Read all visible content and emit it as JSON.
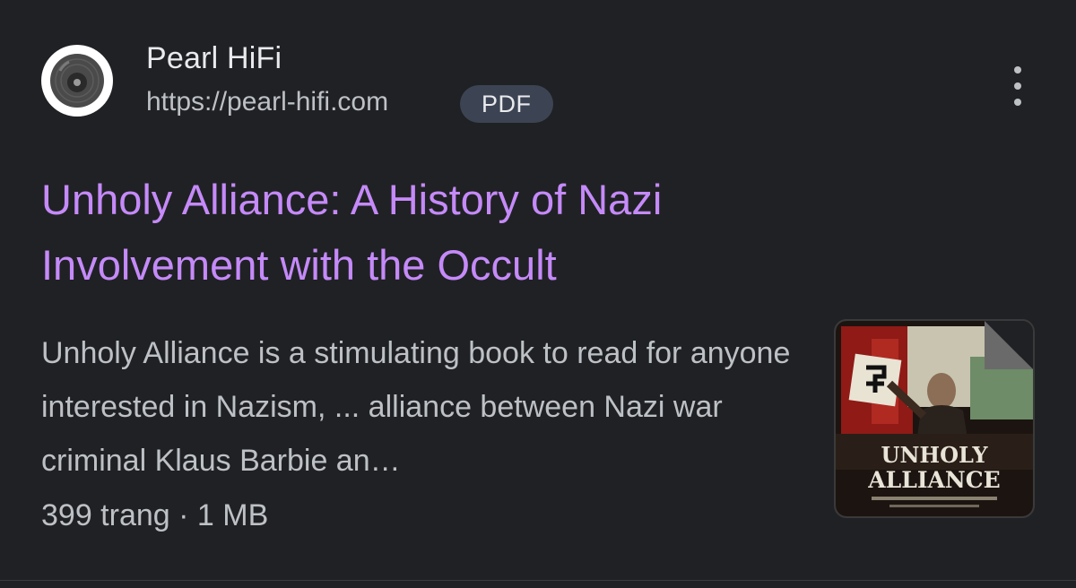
{
  "site": {
    "name": "Pearl HiFi",
    "url": "https://pearl-hifi.com",
    "badge": "PDF",
    "favicon_icon": "vinyl-record-icon"
  },
  "result": {
    "title": "Unholy Alliance: A History of Nazi Involvement with the Occult",
    "snippet": "Unholy Alliance is a stimulating book to read for anyone interested in Nazism, ... alliance between Nazi war criminal Klaus Barbie an…",
    "meta": "399 trang · 1 MB"
  },
  "thumbnail": {
    "cover_title_line1": "UNHOLY",
    "cover_title_line2": "ALLIANCE"
  },
  "colors": {
    "background": "#202124",
    "title_link": "#c58af9",
    "text_primary": "#e8eaed",
    "text_secondary": "#bdc1c6",
    "badge_bg": "#3c4454"
  }
}
